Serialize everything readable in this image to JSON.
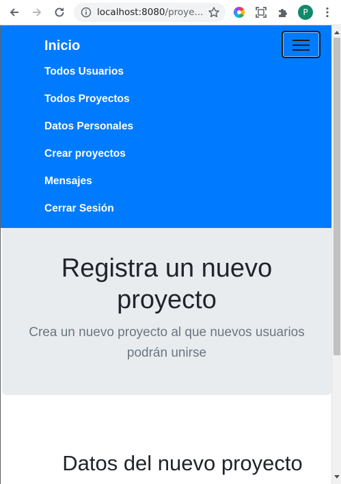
{
  "browser": {
    "url_host": "localhost:8080",
    "url_path": "/proye...",
    "profile_initial": "P"
  },
  "navbar": {
    "brand": "Inicio",
    "items": [
      {
        "label": "Todos Usuarios"
      },
      {
        "label": "Todos Proyectos"
      },
      {
        "label": "Datos Personales"
      },
      {
        "label": "Crear proyectos"
      },
      {
        "label": "Mensajes"
      },
      {
        "label": "Cerrar Sesión"
      }
    ]
  },
  "jumbotron": {
    "title": "Registra un nuevo proyecto",
    "lead": "Crea un nuevo proyecto al que nuevos usuarios podrán unirse"
  },
  "form_section": {
    "title": "Datos del nuevo proyecto"
  },
  "colors": {
    "navbar_bg": "#007bff",
    "jumbotron_bg": "#e9ecef",
    "text_dark": "#212529",
    "text_muted": "#6c757d"
  }
}
